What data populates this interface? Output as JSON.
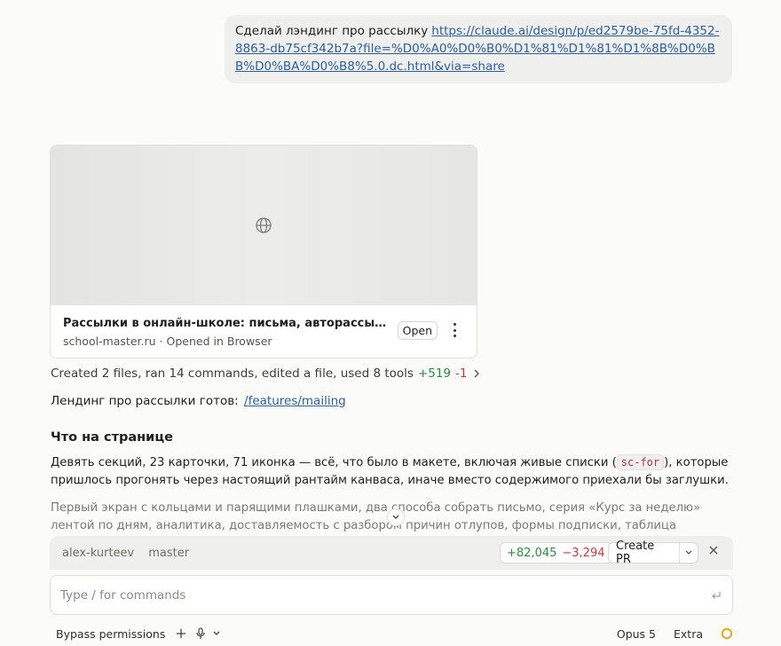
{
  "user_message": {
    "text": "Сделай лэндинг про рассылку",
    "link": "https://claude.ai/design/p/ed2579be-75fd-4352-8863-db75cf342b7a?file=%D0%A0%D0%B0%D1%81%D1%81%D1%8B%D0%BB%D0%BA%D0%B8%5.0.dc.html&via=share"
  },
  "preview": {
    "title": "Рассылки в онлайн-школе: письма, авторассылки, доставляемость | School Master",
    "domain": "school-master.ru",
    "separator": "·",
    "status": "Opened in Browser",
    "open_label": "Open",
    "icon": "globe-icon"
  },
  "summary": {
    "text": "Created 2 files, ran 14 commands, edited a file, used 8 tools",
    "added": "+519",
    "removed": "-1"
  },
  "ready": {
    "text": "Лендинг про рассылки готов:",
    "link": "/features/mailing"
  },
  "section": {
    "title": "Что на странице",
    "para1_before": "Девять секций, 23 карточки, 71 иконка — всё, что было в макете, включая живые списки (",
    "para1_code": "sc-for",
    "para1_after": "), которые пришлось прогонять через настоящий рантайм канваса, иначе вместо содержимого приехали бы заглушки.",
    "para2": "Первый экран с кольцами и парящими плашками, два способа собрать письмо, серия «Курс за неделю» лентой по дням, аналитика, доставляемость с разбором причин отлупов, формы подписки, таблица сравнения с сервисами рассылок на"
  },
  "branch_bar": {
    "user": "alex-kurteev",
    "branch": "master",
    "added": "+82,045",
    "removed": "−3,294",
    "create_pr": "Create PR"
  },
  "composer": {
    "placeholder": "Type / for commands"
  },
  "bottom_bar": {
    "permissions": "Bypass permissions",
    "model": "Opus 5",
    "effort": "Extra"
  },
  "colors": {
    "added": "#2f8a3d",
    "removed": "#c23b3b",
    "link": "#2c5e9e",
    "spinner": "#e8a91c"
  }
}
